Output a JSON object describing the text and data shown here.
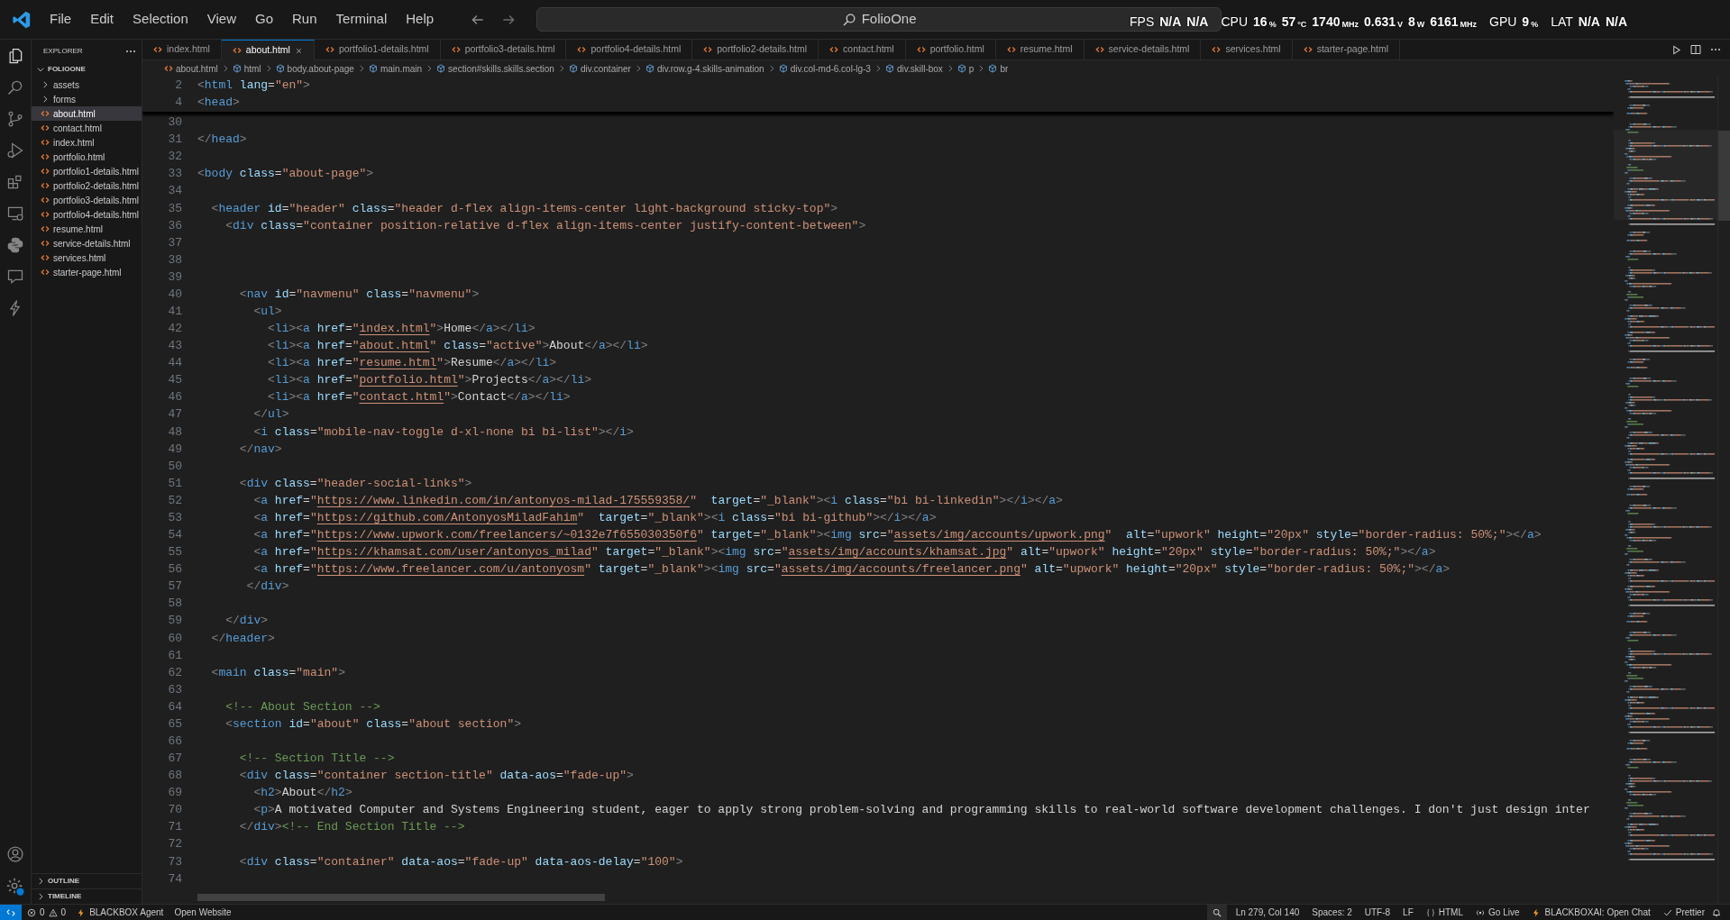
{
  "title_bar": {
    "menus": [
      "File",
      "Edit",
      "Selection",
      "View",
      "Go",
      "Run",
      "Terminal",
      "Help"
    ],
    "search": {
      "value": "FolioOne"
    },
    "overlay": [
      {
        "label": "FPS",
        "readings": [
          {
            "value": "N/A"
          },
          {
            "value": "N/A"
          }
        ]
      },
      {
        "label": "CPU",
        "readings": [
          {
            "value": "16",
            "unit": "%"
          },
          {
            "value": "57",
            "unit": "°C"
          },
          {
            "value": "1740",
            "unit": "MHz"
          },
          {
            "value": "0.631",
            "unit": "V"
          },
          {
            "value": "8",
            "unit": "W"
          },
          {
            "value": "6161",
            "unit": "MHz"
          }
        ]
      },
      {
        "label": "GPU",
        "readings": [
          {
            "value": "9",
            "unit": "%"
          }
        ]
      },
      {
        "label": "LAT",
        "readings": [
          {
            "value": "N/A"
          },
          {
            "value": "N/A"
          }
        ]
      }
    ]
  },
  "sidebar": {
    "title": "EXPLORER",
    "root": {
      "label": "FOLIOONE",
      "expanded": true
    },
    "items": [
      {
        "label": "assets",
        "kind": "folder",
        "expanded": false,
        "selected": false
      },
      {
        "label": "forms",
        "kind": "folder",
        "expanded": false,
        "selected": false
      },
      {
        "label": "about.html",
        "kind": "file",
        "selected": true
      },
      {
        "label": "contact.html",
        "kind": "file",
        "selected": false
      },
      {
        "label": "index.html",
        "kind": "file",
        "selected": false
      },
      {
        "label": "portfolio.html",
        "kind": "file",
        "selected": false
      },
      {
        "label": "portfolio1-details.html",
        "kind": "file",
        "selected": false
      },
      {
        "label": "portfolio2-details.html",
        "kind": "file",
        "selected": false
      },
      {
        "label": "portfolio3-details.html",
        "kind": "file",
        "selected": false
      },
      {
        "label": "portfolio4-details.html",
        "kind": "file",
        "selected": false
      },
      {
        "label": "resume.html",
        "kind": "file",
        "selected": false
      },
      {
        "label": "service-details.html",
        "kind": "file",
        "selected": false
      },
      {
        "label": "services.html",
        "kind": "file",
        "selected": false
      },
      {
        "label": "starter-page.html",
        "kind": "file",
        "selected": false
      }
    ],
    "sections": [
      {
        "label": "OUTLINE",
        "expanded": false
      },
      {
        "label": "TIMELINE",
        "expanded": false
      }
    ]
  },
  "tabs": [
    {
      "label": "index.html",
      "selected": false
    },
    {
      "label": "about.html",
      "selected": true
    },
    {
      "label": "portfolio1-details.html",
      "selected": false
    },
    {
      "label": "portfolio3-details.html",
      "selected": false
    },
    {
      "label": "portfolio4-details.html",
      "selected": false
    },
    {
      "label": "portfolio2-details.html",
      "selected": false
    },
    {
      "label": "contact.html",
      "selected": false
    },
    {
      "label": "portfolio.html",
      "selected": false
    },
    {
      "label": "resume.html",
      "selected": false
    },
    {
      "label": "service-details.html",
      "selected": false
    },
    {
      "label": "services.html",
      "selected": false
    },
    {
      "label": "starter-page.html",
      "selected": false
    }
  ],
  "breadcrumb": [
    "about.html",
    "html",
    "body.about-page",
    "main.main",
    "section#skills.skills.section",
    "div.container",
    "div.row.g-4.skills-animation",
    "div.col-md-6.col-lg-3",
    "div.skill-box",
    "p",
    "br"
  ],
  "editor": {
    "sticky_lines": [
      {
        "number": "2",
        "text": "<html lang=\"en\">"
      },
      {
        "number": "4",
        "text": "<head>"
      }
    ],
    "lines": [
      {
        "number": "30"
      },
      {
        "number": "31",
        "text": "</head>"
      },
      {
        "number": "32"
      },
      {
        "number": "33",
        "text": "<body class=\"about-page\">"
      },
      {
        "number": "34"
      },
      {
        "number": "35",
        "text": "  <header id=\"header\" class=\"header d-flex align-items-center light-background sticky-top\">"
      },
      {
        "number": "36",
        "text": "    <div class=\"container position-relative d-flex align-items-center justify-content-between\">"
      },
      {
        "number": "37"
      },
      {
        "number": "38"
      },
      {
        "number": "39"
      },
      {
        "number": "40",
        "text": "      <nav id=\"navmenu\" class=\"navmenu\">"
      },
      {
        "number": "41",
        "text": "        <ul>"
      },
      {
        "number": "42",
        "text": "          <li><a href=\"index.html\">Home</a></li>"
      },
      {
        "number": "43",
        "text": "          <li><a href=\"about.html\" class=\"active\">About</a></li>"
      },
      {
        "number": "44",
        "text": "          <li><a href=\"resume.html\">Resume</a></li>"
      },
      {
        "number": "45",
        "text": "          <li><a href=\"portfolio.html\">Projects</a></li>"
      },
      {
        "number": "46",
        "text": "          <li><a href=\"contact.html\">Contact</a></li>"
      },
      {
        "number": "47",
        "text": "        </ul>"
      },
      {
        "number": "48",
        "text": "        <i class=\"mobile-nav-toggle d-xl-none bi bi-list\"></i>"
      },
      {
        "number": "49",
        "text": "      </nav>"
      },
      {
        "number": "50"
      },
      {
        "number": "51",
        "text": "      <div class=\"header-social-links\">"
      },
      {
        "number": "52",
        "text": "        <a href=\"https://www.linkedin.com/in/antonyos-milad-175559358/\"  target=\"_blank\"><i class=\"bi bi-linkedin\"></i></a>"
      },
      {
        "number": "53",
        "text": "        <a href=\"https://github.com/AntonyosMiladFahim\"  target=\"_blank\"><i class=\"bi bi-github\"></i></a>"
      },
      {
        "number": "54",
        "text": "        <a href=\"https://www.upwork.com/freelancers/~0132e7f655030350f6\" target=\"_blank\"><img src=\"assets/img/accounts/upwork.png\"  alt=\"upwork\" height=\"20px\" style=\"border-radius: 50%;\"></a>"
      },
      {
        "number": "55",
        "text": "        <a href=\"https://khamsat.com/user/antonyos_milad\" target=\"_blank\"><img src=\"assets/img/accounts/khamsat.jpg\" alt=\"upwork\" height=\"20px\" style=\"border-radius: 50%;\"></a>"
      },
      {
        "number": "56",
        "text": "        <a href=\"https://www.freelancer.com/u/antonyosm\" target=\"_blank\"><img src=\"assets/img/accounts/freelancer.png\" alt=\"upwork\" height=\"20px\" style=\"border-radius: 50%;\"></a>"
      },
      {
        "number": "57",
        "text": "       </div>"
      },
      {
        "number": "58"
      },
      {
        "number": "59",
        "text": "    </div>"
      },
      {
        "number": "60",
        "text": "  </header>"
      },
      {
        "number": "61"
      },
      {
        "number": "62",
        "text": "  <main class=\"main\">"
      },
      {
        "number": "63"
      },
      {
        "number": "64",
        "text": "    <!-- About Section -->"
      },
      {
        "number": "65",
        "text": "    <section id=\"about\" class=\"about section\">"
      },
      {
        "number": "66"
      },
      {
        "number": "67",
        "text": "      <!-- Section Title -->"
      },
      {
        "number": "68",
        "text": "      <div class=\"container section-title\" data-aos=\"fade-up\">"
      },
      {
        "number": "69",
        "text": "        <h2>About</h2>"
      },
      {
        "number": "70",
        "text": "        <p>A motivated Computer and Systems Engineering student, eager to apply strong problem-solving and programming skills to real-world software development challenges. I don't just design inter"
      },
      {
        "number": "71",
        "text": "      </div><!-- End Section Title -->"
      },
      {
        "number": "72"
      },
      {
        "number": "73",
        "text": "      <div class=\"container\" data-aos=\"fade-up\" data-aos-delay=\"100\">"
      },
      {
        "number": "74"
      }
    ]
  },
  "status_bar": {
    "left": [
      {
        "kind": "problems",
        "errors": "0",
        "warnings": "0"
      },
      {
        "kind": "agent",
        "label": "BLACKBOX Agent"
      },
      {
        "kind": "plain",
        "label": "Open Website"
      }
    ],
    "right": [
      {
        "kind": "plain",
        "label": "Ln 279, Col 140"
      },
      {
        "kind": "plain",
        "label": "Spaces: 2"
      },
      {
        "kind": "plain",
        "label": "UTF-8"
      },
      {
        "kind": "plain",
        "label": "LF"
      },
      {
        "kind": "language",
        "label": "HTML"
      },
      {
        "kind": "live",
        "label": "Go Live"
      },
      {
        "kind": "chat",
        "label": "BLACKBOXAI: Open Chat"
      },
      {
        "kind": "check",
        "label": "Prettier"
      }
    ]
  }
}
